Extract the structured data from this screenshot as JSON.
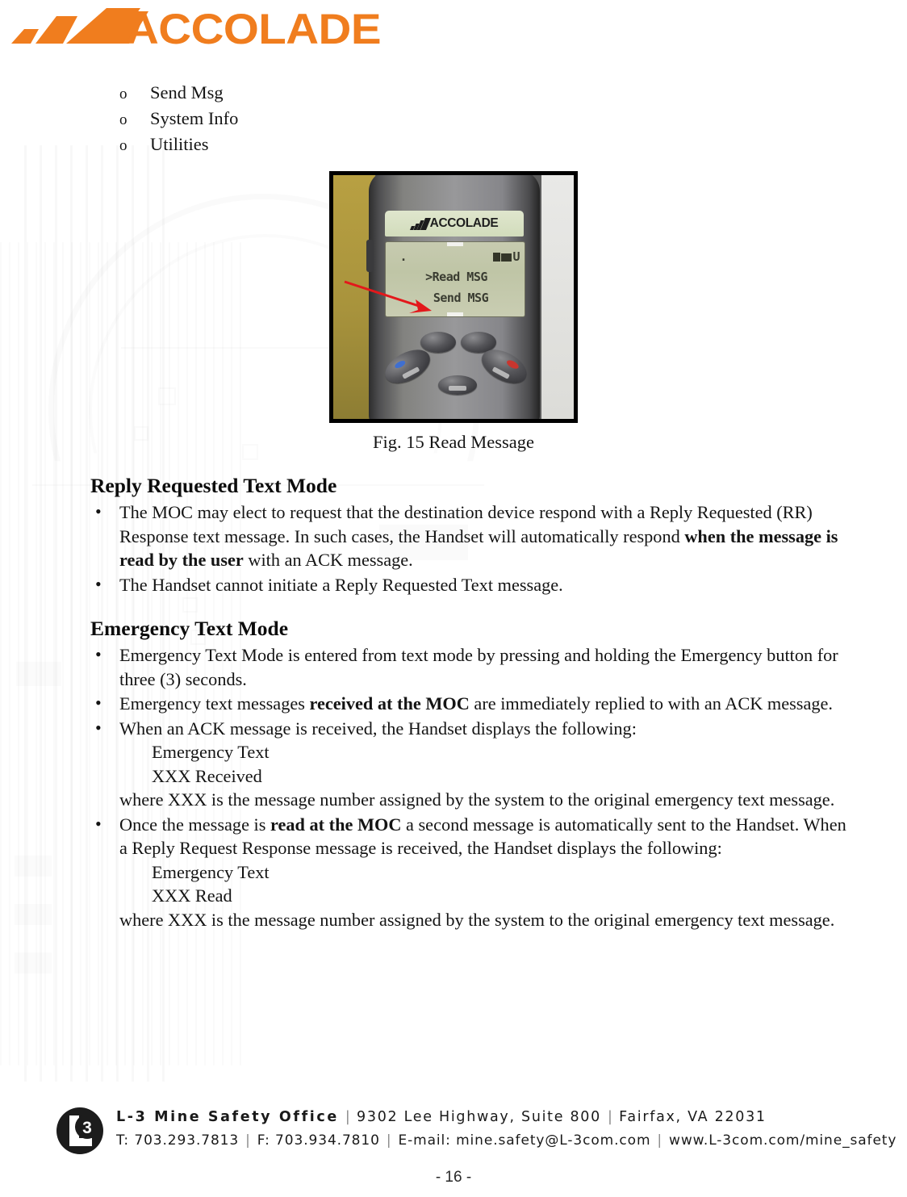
{
  "header": {
    "logo_text": "ACCOLADE",
    "logo_color": "#F07D1E"
  },
  "sub_list": {
    "marker": "o",
    "items": [
      "Send Msg",
      "System Info",
      "Utilities"
    ]
  },
  "figure": {
    "caption": "Fig. 15 Read Message",
    "device": {
      "banner_text": "ACCOLADE",
      "lcd": {
        "status_left": " .",
        "status_right": "U",
        "line1": ">Read MSG",
        "line2": "Send MSG"
      }
    },
    "annotation": "red-arrow-pointing-to-read-msg"
  },
  "sections": [
    {
      "title": "Reply Requested Text Mode",
      "bullets": [
        {
          "parts": [
            {
              "text": "The MOC may elect to request that the destination device respond with a Reply Requested (RR) Response text message.  In such cases, the Handset will automatically respond ",
              "bold": false
            },
            {
              "text": "when the message is read by the user",
              "bold": true
            },
            {
              "text": " with an ACK message.",
              "bold": false
            }
          ]
        },
        {
          "parts": [
            {
              "text": "The Handset cannot initiate a Reply Requested Text message.",
              "bold": false
            }
          ]
        }
      ]
    },
    {
      "title": "Emergency Text Mode",
      "bullets": [
        {
          "parts": [
            {
              "text": "Emergency Text Mode is entered from text mode by pressing and holding the Emergency button for three (3) seconds.",
              "bold": false
            }
          ]
        },
        {
          "parts": [
            {
              "text": "Emergency text messages ",
              "bold": false
            },
            {
              "text": "received at the MOC",
              "bold": true
            },
            {
              "text": " are immediately replied to with an ACK message.",
              "bold": false
            }
          ]
        },
        {
          "parts": [
            {
              "text": "When an ACK message is received, the Handset displays the following:",
              "bold": false
            }
          ],
          "indent_lines": [
            "Emergency Text",
            "XXX Received"
          ],
          "flush_lines": [
            "where XXX is the message number assigned by the system to the original emergency text message."
          ]
        },
        {
          "parts": [
            {
              "text": "Once the message is ",
              "bold": false
            },
            {
              "text": "read at the MOC",
              "bold": true
            },
            {
              "text": " a second message is automatically sent to the Handset.  When a Reply Request Response message is received, the Handset displays the following:",
              "bold": false
            }
          ],
          "indent_lines": [
            "Emergency Text",
            "XXX Read"
          ],
          "flush_lines": [
            "where XXX is the message number assigned by the system to the original emergency text message."
          ]
        }
      ]
    }
  ],
  "footer": {
    "logo_label": "L-3",
    "company": "L-3 Mine Safety Office",
    "address": "9302 Lee Highway, Suite 800",
    "city_state_zip": "Fairfax, VA 22031",
    "phone": "T: 703.293.7813",
    "fax": "F: 703.934.7810",
    "email": "E-mail: mine.safety@L-3com.com",
    "website": "www.L-3com.com/mine_safety",
    "separator": "|"
  },
  "page_number": "- 16 -"
}
